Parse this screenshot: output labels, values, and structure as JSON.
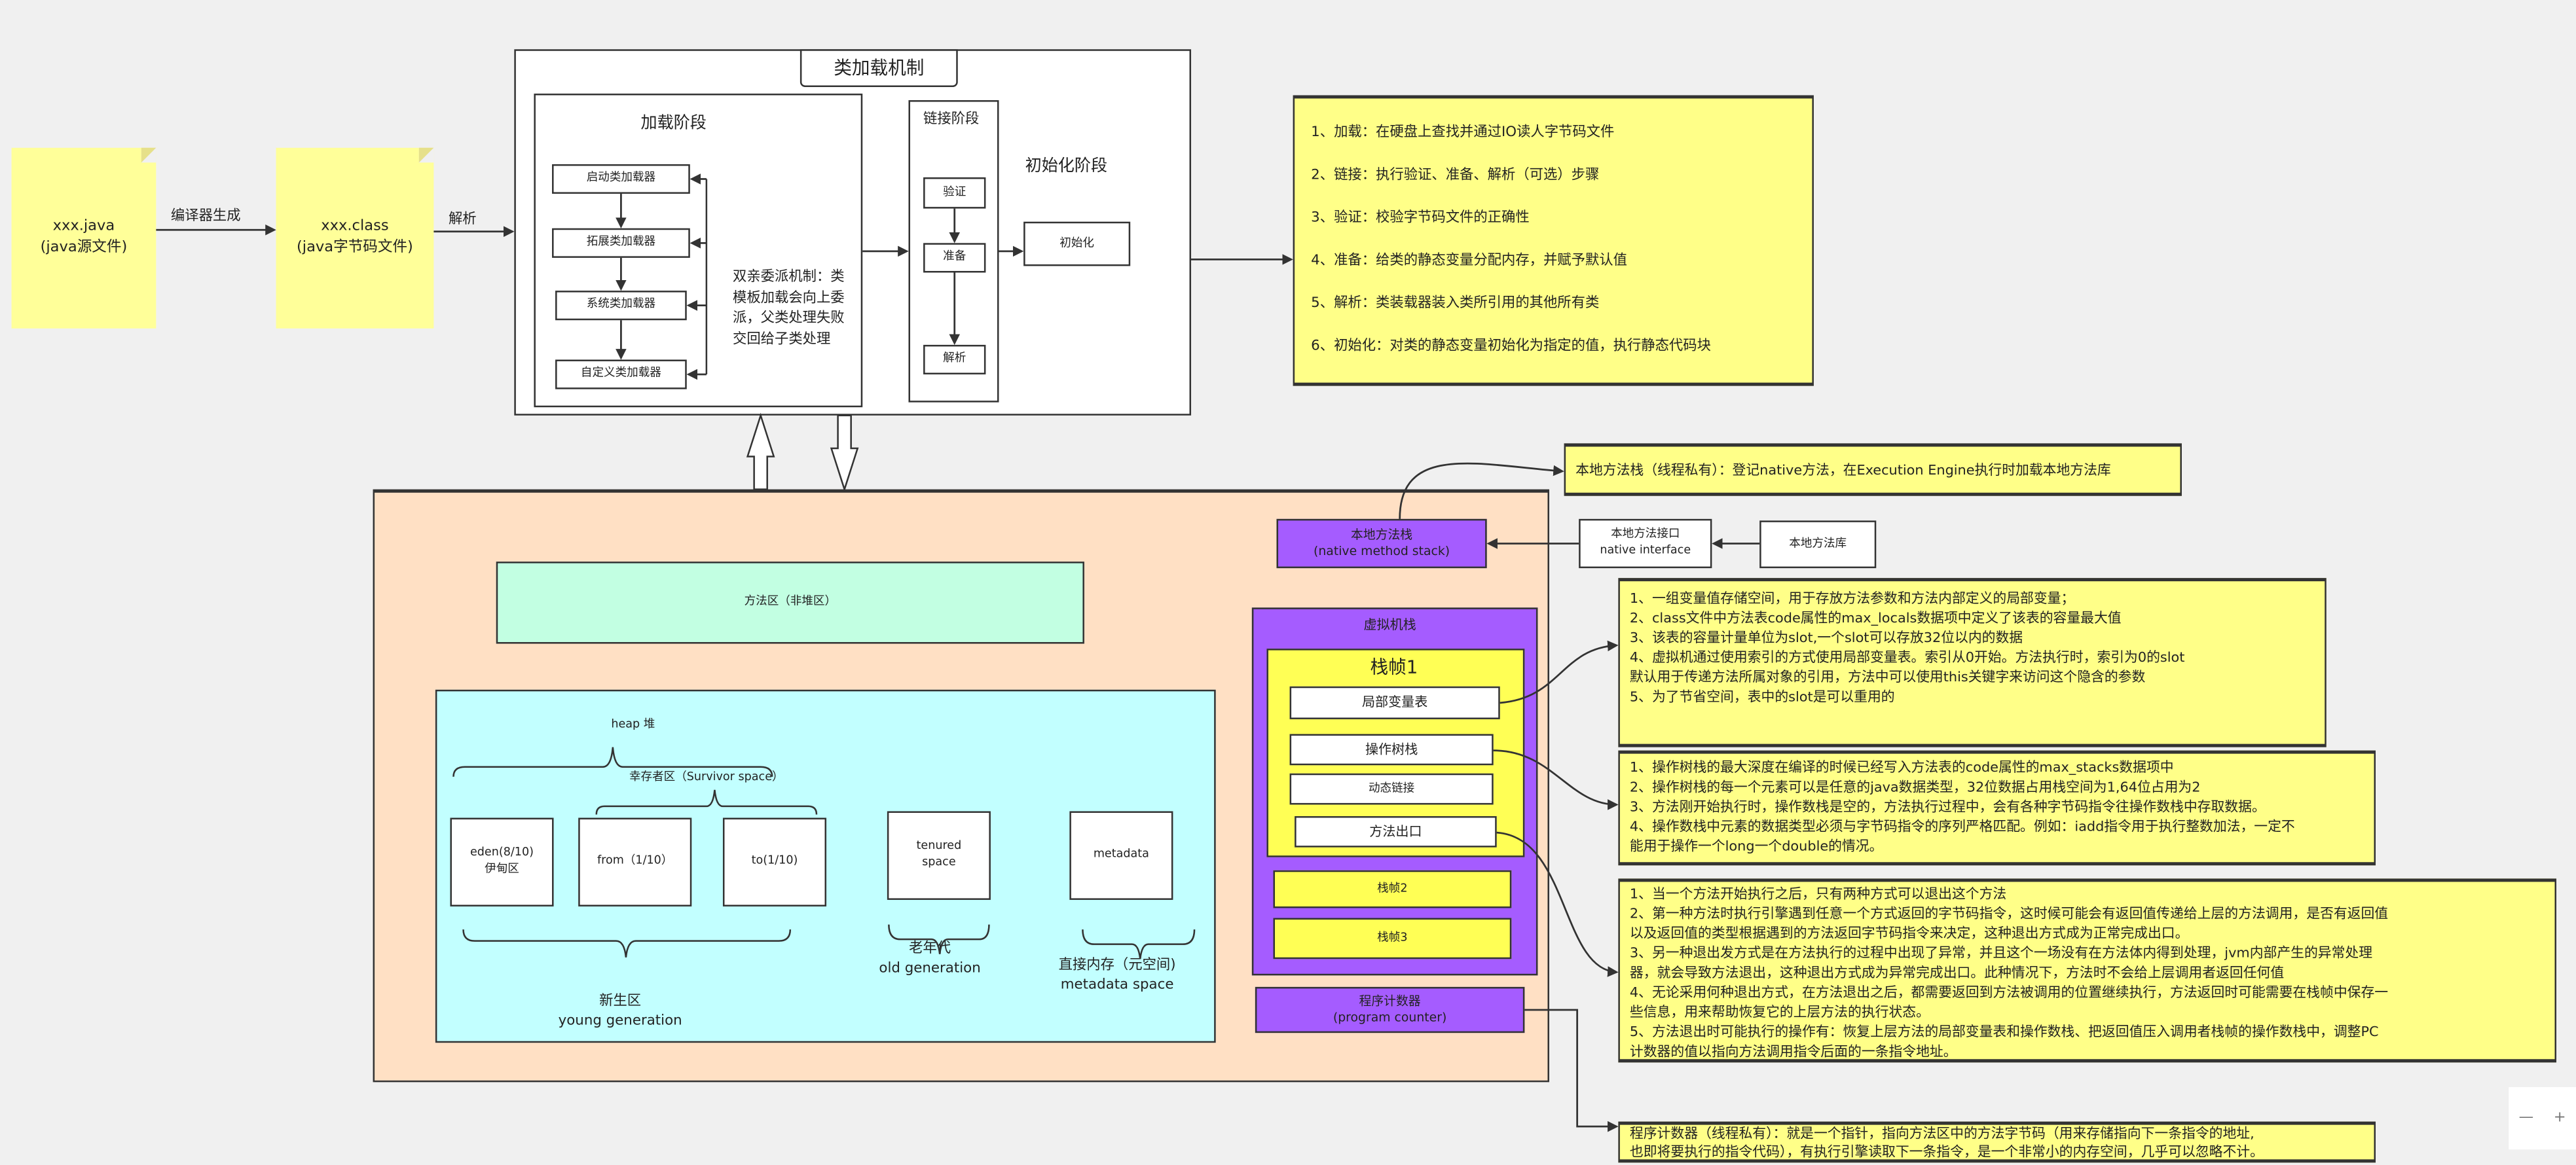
{
  "colors": {
    "sticky": "#ffff99",
    "note": "#ffff88",
    "runtime_area": "#ffe0c4",
    "method_area": "#c2ffe2",
    "heap": "#c2ffff",
    "stack": "#a55cff",
    "frame": "#ffff55"
  },
  "source_file": {
    "line1": "xxx.java",
    "line2": "(java源文件)"
  },
  "compile_label": "编译器生成",
  "class_file": {
    "line1": "xxx.class",
    "line2": "(java字节码文件)"
  },
  "parse_label": "解析",
  "class_loading": {
    "title": "类加载机制",
    "loading_phase": {
      "title": "加载阶段",
      "loaders": [
        "启动类加载器",
        "拓展类加载器",
        "系统类加载器",
        "自定义类加载器"
      ],
      "delegation": "双亲委派机制：类模板加载会向上委派，父类处理失败交回给子类处理"
    },
    "linking_phase": {
      "title": "链接阶段",
      "steps": [
        "验证",
        "准备",
        "解析"
      ]
    },
    "init_phase": {
      "title": "初始化阶段",
      "step": "初始化"
    }
  },
  "loading_notes": [
    "1、加载：在硬盘上查找并通过IO读人字节码文件",
    "2、链接：执行验证、准备、解析（可选）步骤",
    "3、验证：校验字节码文件的正确性",
    "4、准备：给类的静态变量分配内存，并赋予默认值",
    "5、解析：类装载器装入类所引用的其他所有类",
    "6、初始化：对类的静态变量初始化为指定的值，执行静态代码块"
  ],
  "runtime": {
    "method_area": "方法区（非堆区）",
    "heap": {
      "title": "heap 堆",
      "survivor": "幸存者区（Survivor space）",
      "eden_line1": "eden(8/10)",
      "eden_line2": "伊甸区",
      "from": "from（1/10）",
      "to": "to(1/10)",
      "tenured_line1": "tenured",
      "tenured_line2": "space",
      "metadata": "metadata",
      "young_cn": "新生区",
      "young_en": "young generation",
      "old_cn": "老年代",
      "old_en": "old generation",
      "meta_cn": "直接内存（元空间)",
      "meta_en": "metadata space"
    },
    "native_stack": {
      "cn": "本地方法栈",
      "en": "(native method stack)"
    },
    "vm_stack": {
      "title": "虚拟机栈",
      "frame1": "栈帧1",
      "items": [
        "局部变量表",
        "操作树栈",
        "动态链接",
        "方法出口"
      ],
      "frame2": "栈帧2",
      "frame3": "栈帧3"
    },
    "pc": {
      "cn": "程序计数器",
      "en": "(program counter)"
    }
  },
  "native_interface": {
    "cn": "本地方法接口",
    "en": "native interface"
  },
  "native_library": "本地方法库",
  "native_note": "本地方法栈（线程私有）：登记native方法，在Execution Engine执行时加载本地方法库",
  "local_var_notes": [
    "1、一组变量值存储空间，用于存放方法参数和方法内部定义的局部变量；",
    "2、class文件中方法表code属性的max_locals数据项中定义了该表的容量最大值",
    "3、该表的容量计量单位为slot,一个slot可以存放32位以内的数据",
    "4、虚拟机通过使用索引的方式使用局部变量表。索引从0开始。方法执行时，索引为0的slot",
    "默认用于传递方法所属对象的引用，方法中可以使用this关键字来访问这个隐含的参数",
    "5、为了节省空间，表中的slot是可以重用的"
  ],
  "operand_notes": [
    "1、操作树栈的最大深度在编译的时候已经写入方法表的code属性的max_stacks数据项中",
    "2、操作树栈的每一个元素可以是任意的java数据类型，32位数据占用栈空间为1,64位占用为2",
    "3、方法刚开始执行时，操作数栈是空的，方法执行过程中，会有各种字节码指令往操作数栈中存取数据。",
    "4、操作数栈中元素的数据类型必须与字节码指令的序列严格匹配。例如：iadd指令用于执行整数加法，一定不",
    "能用于操作一个long一个double的情况。"
  ],
  "return_notes": [
    "1、当一个方法开始执行之后，只有两种方式可以退出这个方法",
    "2、第一种方法时执行引擎遇到任意一个方式返回的字节码指令，这时候可能会有返回值传递给上层的方法调用，是否有返回值",
    "以及返回值的类型根据遇到的方法返回字节码指令来决定，这种退出方式成为正常完成出口。",
    "3、另一种退出发方式是在方法执行的过程中出现了异常，并且这个一场没有在方法体内得到处理，jvm内部产生的异常处理",
    "器，就会导致方法退出，这种退出方式成为异常完成出口。此种情况下，方法时不会给上层调用者返回任何值",
    "4、无论采用何种退出方式，在方法退出之后，都需要返回到方法被调用的位置继续执行，方法返回时可能需要在栈帧中保存一",
    "些信息，用来帮助恢复它的上层方法的执行状态。",
    "5、方法退出时可能执行的操作有：恢复上层方法的局部变量表和操作数栈、把返回值压入调用者栈帧的操作数栈中，调整PC",
    "计数器的值以指向方法调用指令后面的一条指令地址。"
  ],
  "pc_notes": [
    "程序计数器（线程私有）：就是一个指针，指向方法区中的方法字节码（用来存储指向下一条指令的地址,",
    "也即将要执行的指令代码），有执行引擎读取下一条指令，是一个非常小的内存空间，几乎可以忽略不计。"
  ],
  "zoom_control": {
    "minus": "—",
    "plus": "+"
  }
}
